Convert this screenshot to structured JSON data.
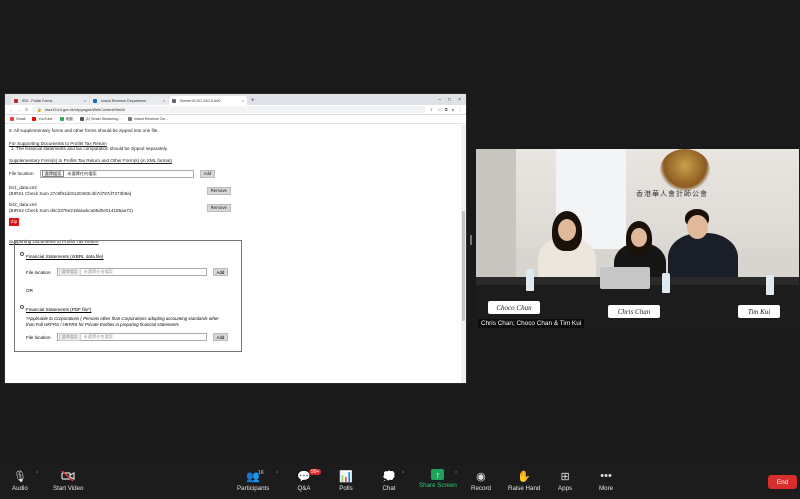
{
  "browser": {
    "tabs": [
      {
        "label": "IRD - Public Forms",
        "active": false
      },
      {
        "label": "Inland Revenue Department",
        "active": false
      },
      {
        "label": "Screen ID:SC-S10-0-A00",
        "active": true
      }
    ],
    "url": "etax13.ird.gov.hk/ntp/pages/WebContent/html/#",
    "bookmarks": [
      "Gmail",
      "YouTube",
      "地圖",
      "(1) Smart Streaming...",
      "Inland Revenue De..."
    ]
  },
  "page": {
    "line3": "3.  All supplementary forms and other forms should be zipped into one file.",
    "supporting_docs_heading": "For Supporting Documents to Profits Tax Return",
    "supporting_docs_note": "1.  The financial statements and tax computation should be zipped separately.",
    "supplementary_heading": "Supplementary Form(s) to Profits Tax Return and Other Form(s) (in XML format)",
    "file_location_label": "File location",
    "choose_file": "選擇檔案",
    "no_file_chosen": "未選擇任何檔案",
    "add": "Add",
    "files": [
      {
        "name": "bir1_data.xml",
        "checksum": "(BIRS1 Check Sum 27c8f91dc8130483c4b7d787d7273b9a)",
        "remove": "Remove"
      },
      {
        "name": "bir2_data.xml",
        "checksum": "(BIRS2 Check Sum d0c3376e219aeabca05d0e014185aa71)",
        "remove": "Remove"
      }
    ],
    "zip_button": "Zip",
    "supporting_heading2": "Supporting Documents to Profits Tax Return",
    "option1_label": "Financial Statements (iXBRL data file)",
    "or_label": "OR",
    "option2_label": "Financial Statements (PDF file*)",
    "option2_note": "*Applicable to Corporations ( Persons other than Corporations adopting accounting standards other than Full HKFRS / HKFRS for Private Entities in preparing financial statements"
  },
  "video": {
    "caption": "Chris Chan; Choco Chan & Tim Kui",
    "nameplates": [
      "Choco Chan",
      "Chris Chan",
      "Tim Kui"
    ],
    "wall_sign": "香港華人會計師公會"
  },
  "toolbar": {
    "audio": "Audio",
    "video": "Start Video",
    "participants": "Participants",
    "participants_count": "1K",
    "qa": "Q&A",
    "qa_badge": "99+",
    "polls": "Polls",
    "chat": "Chat",
    "share": "Share Screen",
    "record": "Record",
    "raise_hand": "Raise Hand",
    "apps": "Apps",
    "more": "More",
    "end": "End"
  }
}
